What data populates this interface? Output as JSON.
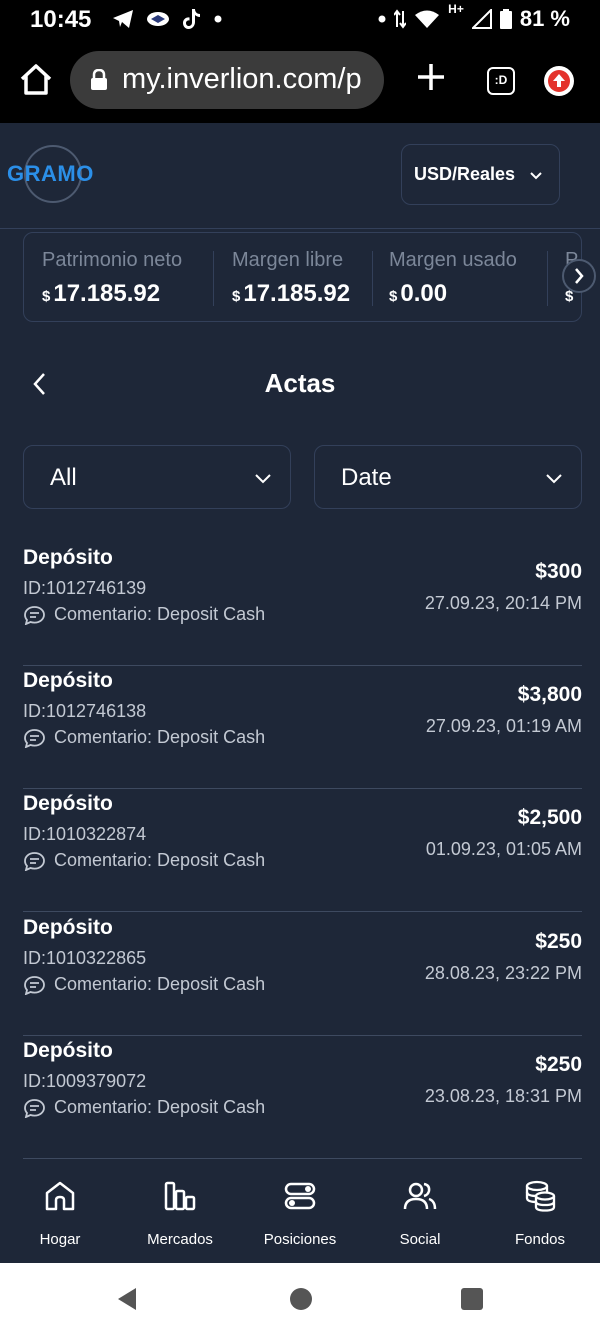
{
  "status_bar": {
    "time": "10:45",
    "battery": "81 %",
    "network": "H+",
    "icons": [
      "telegram-icon",
      "app-icon",
      "tiktok-icon",
      "dot-icon",
      "wifi-icon",
      "signal-icon",
      "battery-icon"
    ]
  },
  "browser": {
    "url": "my.inverlion.com/p",
    "tabs_label": ":D"
  },
  "header": {
    "logo_text": "GRAMO",
    "currency_label": "USD/Reales"
  },
  "stats": [
    {
      "title": "Patrimonio neto",
      "currency": "$",
      "value": "17.185.92"
    },
    {
      "title": "Margen libre",
      "currency": "$",
      "value": "17.185.92"
    },
    {
      "title": "Margen usado",
      "currency": "$",
      "value": "0.00"
    },
    {
      "title": "P",
      "currency": "$",
      "value": ""
    }
  ],
  "page": {
    "title": "Actas"
  },
  "filters": {
    "type_value": "All",
    "date_value": "Date"
  },
  "transactions": [
    {
      "type": "Depósito",
      "id": "ID:1012746139",
      "comment": "Comentario: Deposit Cash",
      "amount": "$300",
      "date": "27.09.23, 20:14 PM"
    },
    {
      "type": "Depósito",
      "id": "ID:1012746138",
      "comment": "Comentario: Deposit Cash",
      "amount": "$3,800",
      "date": "27.09.23, 01:19 AM"
    },
    {
      "type": "Depósito",
      "id": "ID:1010322874",
      "comment": "Comentario: Deposit Cash",
      "amount": "$2,500",
      "date": "01.09.23, 01:05 AM"
    },
    {
      "type": "Depósito",
      "id": "ID:1010322865",
      "comment": "Comentario: Deposit Cash",
      "amount": "$250",
      "date": "28.08.23, 23:22 PM"
    },
    {
      "type": "Depósito",
      "id": "ID:1009379072",
      "comment": "Comentario: Deposit Cash",
      "amount": "$250",
      "date": "23.08.23, 18:31 PM"
    }
  ],
  "bottom_nav": [
    {
      "label": "Hogar",
      "icon": "home-icon"
    },
    {
      "label": "Mercados",
      "icon": "bar-chart-icon"
    },
    {
      "label": "Posiciones",
      "icon": "toggles-icon"
    },
    {
      "label": "Social",
      "icon": "users-icon"
    },
    {
      "label": "Fondos",
      "icon": "coins-icon"
    }
  ],
  "colors": {
    "background": "#1e2738",
    "border": "#33405a",
    "accent": "#2b8fe8",
    "muted_text": "#7c8799"
  }
}
